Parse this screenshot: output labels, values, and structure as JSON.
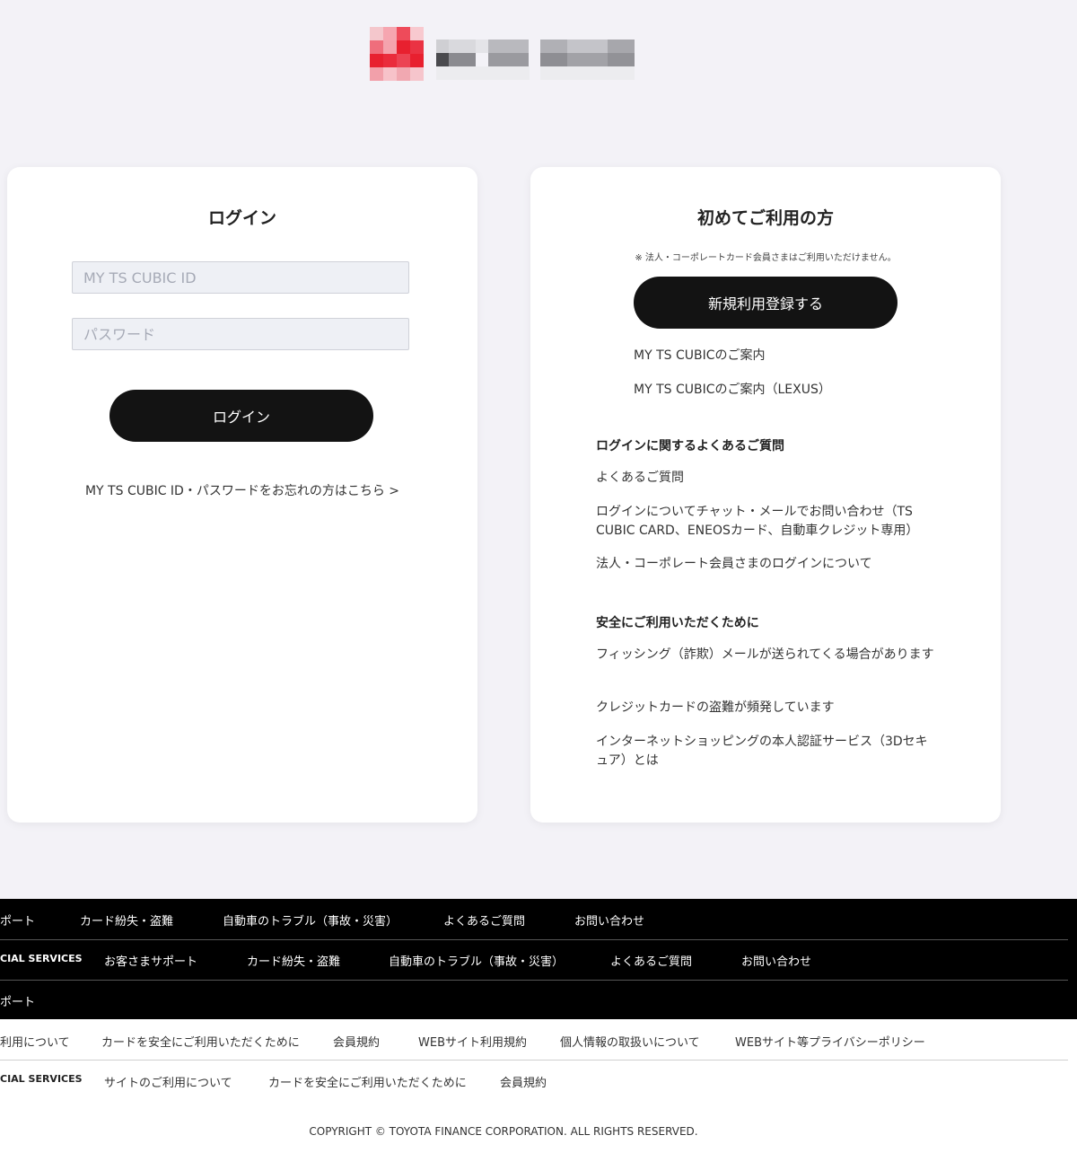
{
  "login": {
    "title": "ログイン",
    "id_placeholder": "MY TS CUBIC ID",
    "password_placeholder": "パスワード",
    "button_label": "ログイン",
    "forgot_link": "MY TS CUBIC ID・パスワードをお忘れの方はこちら >"
  },
  "register": {
    "title": "初めてご利用の方",
    "note": "※ 法人・コーポレートカード会員さまはご利用いただけません。",
    "button_label": "新規利用登録する",
    "guide_link": "MY TS CUBICのご案内",
    "guide_lexus_link": "MY TS CUBICのご案内（LEXUS）",
    "faq_heading": "ログインに関するよくあるご質問",
    "faq_links": [
      "よくあるご質問",
      "ログインについてチャット・メールでお問い合わせ（TS CUBIC CARD、ENEOSカード、自動車クレジット専用）",
      "法人・コーポレート会員さまのログインについて"
    ],
    "safety_heading": "安全にご利用いただくために",
    "safety_links": [
      "フィッシング（詐欺）メールが送られてくる場合があります",
      "クレジットカードの盗難が頻発しています",
      "インターネットショッピングの本人認証サービス（3Dセキュア）とは"
    ]
  },
  "footer": {
    "row1": [
      "ポート",
      "カード紛失・盗難",
      "自動車のトラブル（事故・災害）",
      "よくあるご質問",
      "お問い合わせ"
    ],
    "row2_brand": "CIAL SERVICES",
    "row2": [
      "お客さまサポート",
      "カード紛失・盗難",
      "自動車のトラブル（事故・災害）",
      "よくあるご質問",
      "お問い合わせ"
    ],
    "row3": [
      "ポート"
    ],
    "row4": [
      "利用について",
      "カードを安全にご利用いただくために",
      "会員規約",
      "WEBサイト利用規約",
      "個人情報の取扱いについて",
      "WEBサイト等プライバシーポリシー"
    ],
    "row5_brand": "CIAL SERVICES",
    "row5": [
      "サイトのご利用について",
      "カードを安全にご利用いただくために",
      "会員規約"
    ],
    "copyright": "COPYRIGHT © TOYOTA FINANCE CORPORATION. ALL RIGHTS RESERVED."
  },
  "colors": {
    "background": "#f3f2f7",
    "button": "#131313",
    "footer_dark": "#000000",
    "logo_red": "#e8202f"
  }
}
